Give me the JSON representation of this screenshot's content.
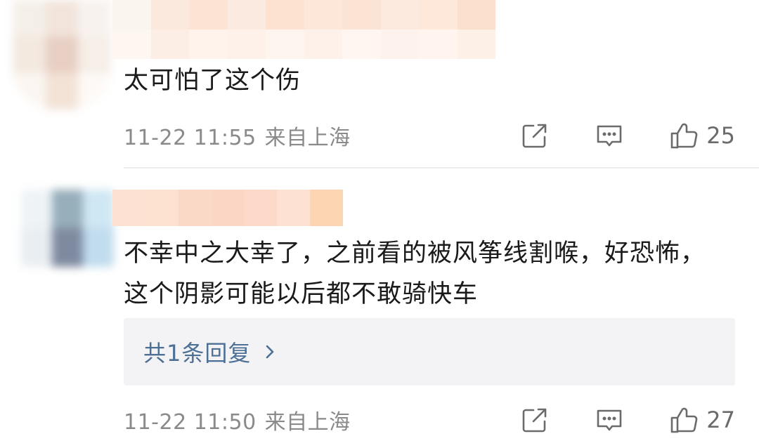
{
  "comments": [
    {
      "text": "太可怕了这个伤",
      "time": "11-22 11:55",
      "location": "来自上海",
      "actions": {
        "share_icon": "share-icon",
        "comment_icon": "comment-icon",
        "like_icon": "thumbs-up-icon",
        "likes": "25"
      }
    },
    {
      "text": "不幸中之大幸了，之前看的被风筝线割喉，好恐怖，这个阴影可能以后都不敢骑快车",
      "reply_link": "共1条回复",
      "time": "11-22 11:50",
      "location": "来自上海",
      "actions": {
        "share_icon": "share-icon",
        "comment_icon": "comment-icon",
        "like_icon": "thumbs-up-icon",
        "likes": "27"
      }
    }
  ],
  "colors": {
    "text": "#1a1a1a",
    "meta": "#8a8a8a",
    "reply_link": "#4c6f96",
    "reply_box_bg": "#f3f3f5",
    "divider": "#ececec"
  }
}
